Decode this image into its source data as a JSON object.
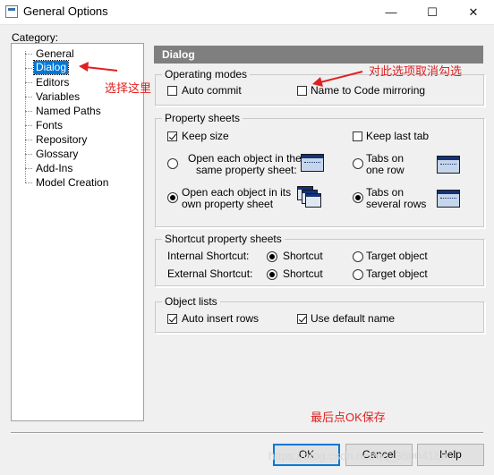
{
  "window": {
    "title": "General Options",
    "minimize_glyph": "—",
    "maximize_glyph": "☐",
    "close_glyph": "✕",
    "icon": "options-dialog-icon"
  },
  "category": {
    "label": "Category:",
    "items": [
      {
        "label": "General",
        "selected": false
      },
      {
        "label": "Dialog",
        "selected": true
      },
      {
        "label": "Editors",
        "selected": false
      },
      {
        "label": "Variables",
        "selected": false
      },
      {
        "label": "Named Paths",
        "selected": false
      },
      {
        "label": "Fonts",
        "selected": false
      },
      {
        "label": "Repository",
        "selected": false
      },
      {
        "label": "Glossary",
        "selected": false
      },
      {
        "label": "Add-Ins",
        "selected": false
      },
      {
        "label": "Model Creation",
        "selected": false
      }
    ]
  },
  "panel": {
    "title": "Dialog",
    "operating_modes": {
      "title": "Operating modes",
      "auto_commit": {
        "label": "Auto commit",
        "checked": false
      },
      "name_to_code": {
        "label": "Name to Code mirroring",
        "checked": false
      }
    },
    "property_sheets": {
      "title": "Property sheets",
      "keep_size": {
        "label": "Keep size",
        "checked": true
      },
      "keep_last_tab": {
        "label": "Keep last tab",
        "checked": false
      },
      "open_same_line1": "Open each object in the",
      "open_same_line2": "same property sheet:",
      "open_own_line1": "Open each object in its",
      "open_own_line2": "own property sheet",
      "open_mode_selected": "own",
      "tabs_one_line1": "Tabs on",
      "tabs_one_line2": "one row",
      "tabs_several_line1": "Tabs on",
      "tabs_several_line2": "several rows",
      "tabs_mode_selected": "several"
    },
    "shortcut_sheets": {
      "title": "Shortcut property sheets",
      "internal_label": "Internal Shortcut:",
      "external_label": "External Shortcut:",
      "shortcut_option": "Shortcut",
      "target_option": "Target object",
      "internal_selected": "shortcut",
      "external_selected": "shortcut"
    },
    "object_lists": {
      "title": "Object lists",
      "auto_insert": {
        "label": "Auto insert rows",
        "checked": true
      },
      "use_default_name": {
        "label": "Use default name",
        "checked": true
      }
    }
  },
  "buttons": {
    "ok": "OK",
    "cancel": "Cancel",
    "help": "Help"
  },
  "annotations": {
    "select_here": "选择这里",
    "uncheck_option": "对此选项取消勾选",
    "ok_save": "最后点OK保存",
    "color": "#e02020"
  },
  "watermark": "https://blog.csdn.net/qq_36004189"
}
